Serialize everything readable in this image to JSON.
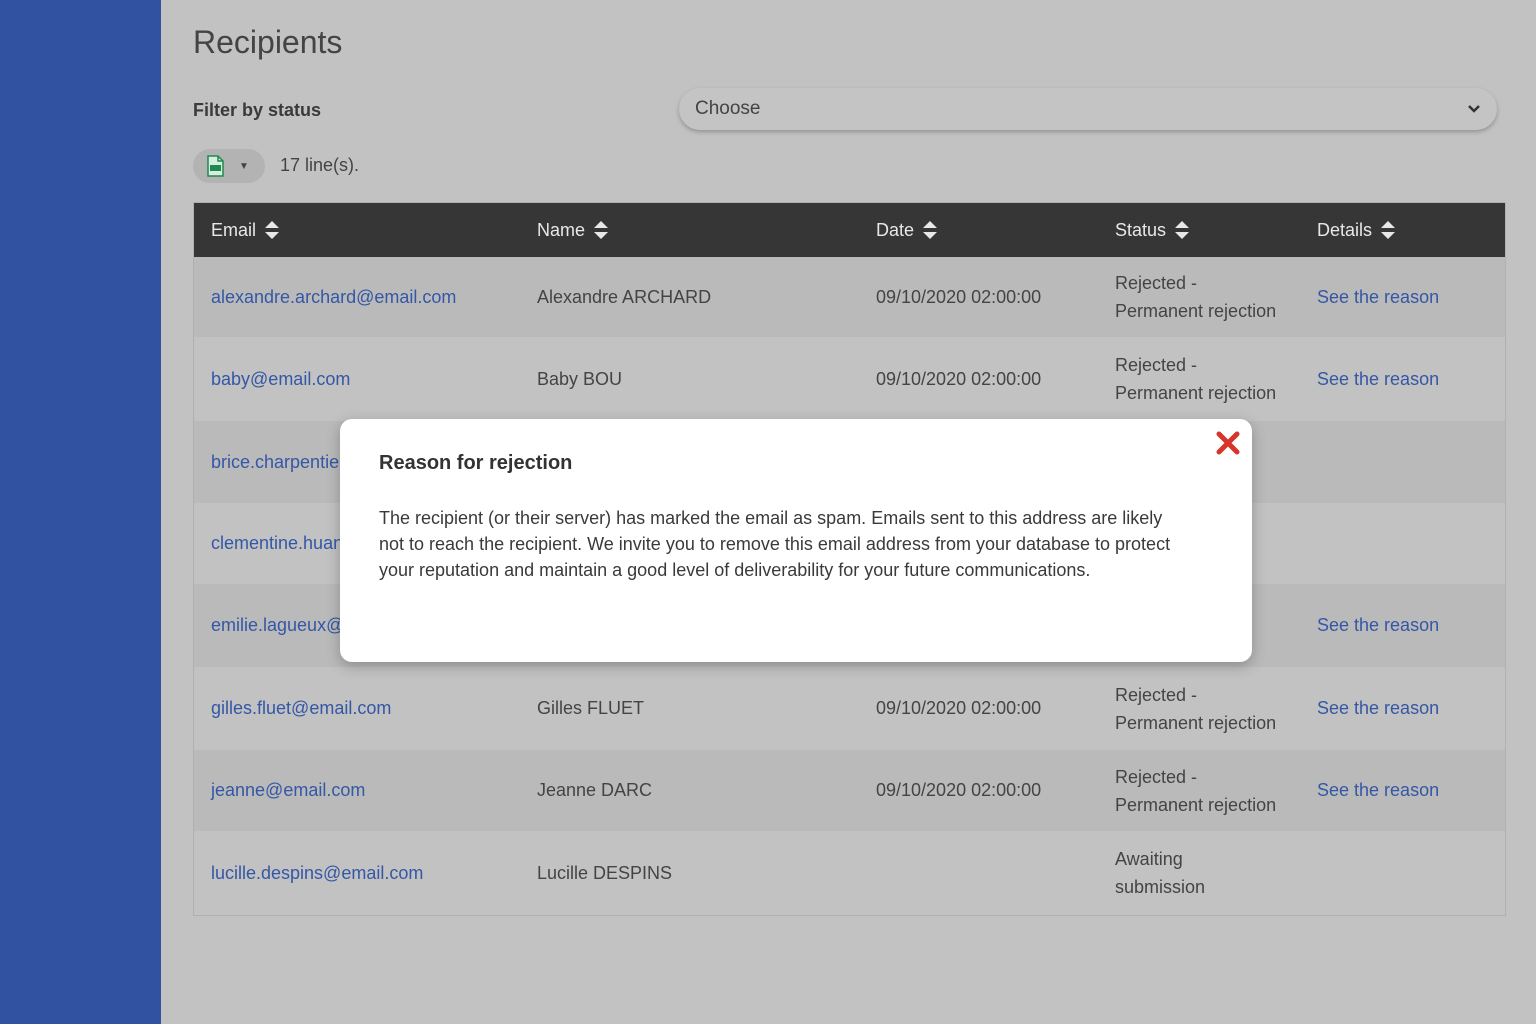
{
  "page": {
    "title": "Recipients",
    "filter_label": "Filter by status",
    "filter_select_value": "Choose",
    "line_count": "17 line(s)."
  },
  "table": {
    "headers": [
      "Email",
      "Name",
      "Date",
      "Status",
      "Details"
    ],
    "rows": [
      {
        "email": "alexandre.archard@email.com",
        "name": "Alexandre ARCHARD",
        "date": "09/10/2020 02:00:00",
        "status_1": "Rejected -",
        "status_2": "Permanent rejection",
        "details": "See the reason"
      },
      {
        "email": "baby@email.com",
        "name": "Baby BOU",
        "date": "09/10/2020 02:00:00",
        "status_1": "Rejected -",
        "status_2": "Permanent rejection",
        "details": "See the reason"
      },
      {
        "email": "brice.charpentie",
        "name": "",
        "date": "",
        "status_1": "",
        "status_2": "",
        "details": ""
      },
      {
        "email": "clementine.huan",
        "name": "",
        "date": "",
        "status_1": "",
        "status_2": "",
        "details": ""
      },
      {
        "email": "emilie.lagueux@e",
        "name": "",
        "date": "",
        "status_1": "",
        "status_2": "",
        "details": "See the reason"
      },
      {
        "email": "gilles.fluet@email.com",
        "name": "Gilles FLUET",
        "date": "09/10/2020 02:00:00",
        "status_1": "Rejected -",
        "status_2": "Permanent rejection",
        "details": "See the reason"
      },
      {
        "email": "jeanne@email.com",
        "name": "Jeanne DARC",
        "date": "09/10/2020 02:00:00",
        "status_1": "Rejected -",
        "status_2": "Permanent rejection",
        "details": "See the reason"
      },
      {
        "email": "lucille.despins@email.com",
        "name": "Lucille DESPINS",
        "date": "",
        "status_1": "Awaiting",
        "status_2": "submission",
        "details": ""
      }
    ]
  },
  "modal": {
    "title": "Reason for rejection",
    "body": "The recipient (or their server) has marked the email as spam. Emails sent to this address are likely not to reach the recipient. We invite you to remove this email address from your database to protect your reputation and maintain a good level of deliverability for your future communications."
  },
  "colors": {
    "sidebar": "#3052a0",
    "link": "#3457a6",
    "header_bg": "#363636",
    "close_icon": "#d9342b",
    "excel_icon": "#1e8a4c"
  },
  "icons": {
    "export": "excel-file-icon",
    "sort": "sort-icon",
    "close": "close-icon",
    "select": "chevron-down-icon"
  }
}
